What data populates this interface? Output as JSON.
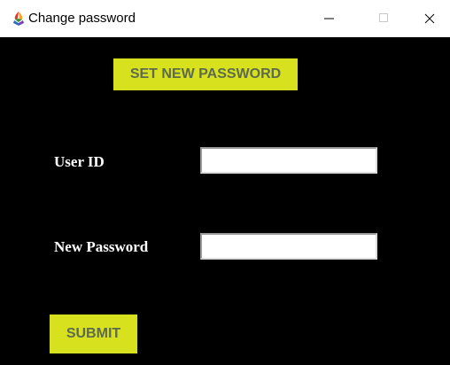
{
  "window": {
    "title": "Change password",
    "app_icon": "tk-feather-icon",
    "controls": [
      "minimize-icon",
      "maximize-icon",
      "close-icon"
    ]
  },
  "form": {
    "heading": "SET NEW PASSWORD",
    "user_id_label": "User ID",
    "user_id_value": "",
    "new_password_label": "New Password",
    "new_password_value": "",
    "submit_label": "SUBMIT"
  },
  "colors": {
    "background": "#000000",
    "accent": "#d7e11d",
    "accent_text": "#5d6a4d",
    "label_text": "#ffffff"
  }
}
